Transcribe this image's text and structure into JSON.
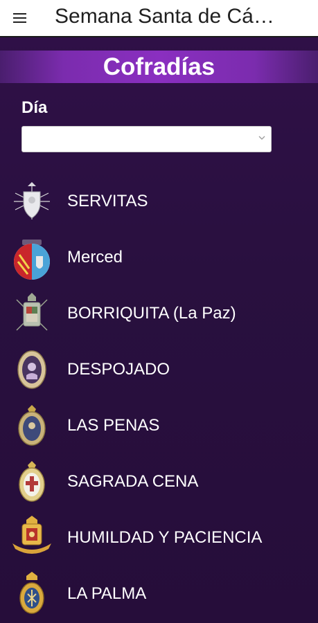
{
  "appbar": {
    "title": "Semana Santa de Cá…",
    "menu_icon": "hamburger-menu-icon"
  },
  "section": {
    "title": "Cofradías"
  },
  "filter": {
    "label": "Día",
    "selected_value": ""
  },
  "cofradias": [
    {
      "name": "SERVITAS",
      "icon": "servitas-crest-icon"
    },
    {
      "name": "Merced",
      "icon": "merced-crest-icon"
    },
    {
      "name": "BORRIQUITA (La Paz)",
      "icon": "borriquita-crest-icon"
    },
    {
      "name": "DESPOJADO",
      "icon": "despojado-crest-icon"
    },
    {
      "name": "LAS PENAS",
      "icon": "las-penas-crest-icon"
    },
    {
      "name": "SAGRADA CENA",
      "icon": "sagrada-cena-crest-icon"
    },
    {
      "name": "HUMILDAD Y PACIENCIA",
      "icon": "humildad-paciencia-crest-icon"
    },
    {
      "name": "LA PALMA",
      "icon": "la-palma-crest-icon"
    }
  ],
  "colors": {
    "background": "#2a0f43",
    "band_accent": "#8a2fc0",
    "appbar": "#ffffff"
  }
}
